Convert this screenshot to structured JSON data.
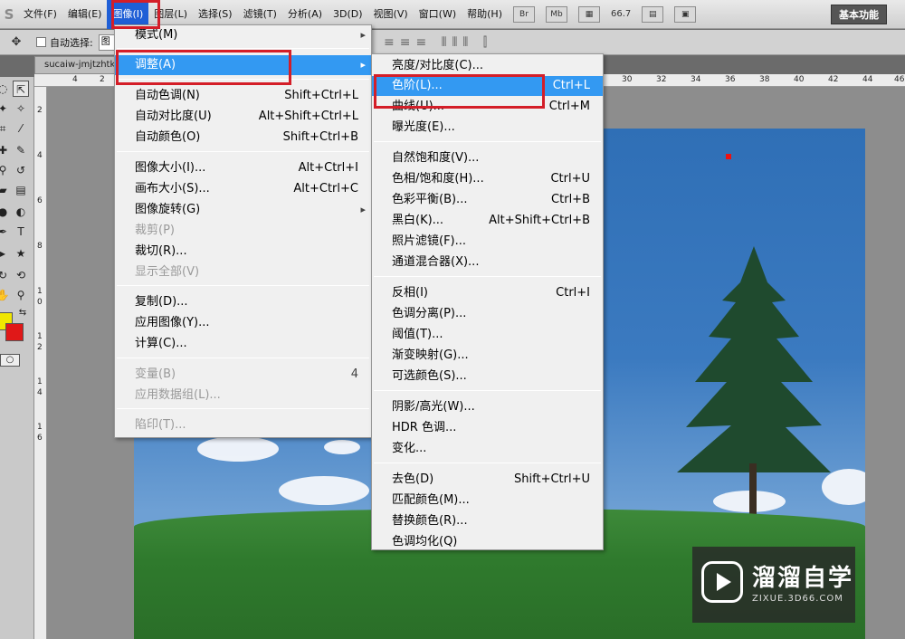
{
  "menubar": {
    "items": [
      "文件(F)",
      "编辑(E)",
      "图像(I)",
      "图层(L)",
      "选择(S)",
      "滤镜(T)",
      "分析(A)",
      "3D(D)",
      "视图(V)",
      "窗口(W)",
      "帮助(H)"
    ],
    "bridge_label": "Br",
    "minibridge_label": "Mb",
    "zoom": "66.7",
    "workspace": "基本功能"
  },
  "options": {
    "auto_select_label": "自动选择:",
    "auto_select_value": "图"
  },
  "document": {
    "tab_title": "sucaiw-jmjtzhtk"
  },
  "rulers": {
    "h_left": [
      "4",
      "2"
    ],
    "h_right": [
      "30",
      "32",
      "34",
      "36",
      "38",
      "40",
      "42",
      "44",
      "46"
    ],
    "v": [
      "2",
      "4",
      "6",
      "8",
      "1",
      "0",
      "1",
      "2",
      "1",
      "4",
      "1",
      "6"
    ]
  },
  "image_menu": {
    "items": [
      {
        "label": "模式(M)",
        "shortcut": ""
      },
      {
        "label": "调整(A)",
        "shortcut": ""
      },
      {
        "label": "自动色调(N)",
        "shortcut": "Shift+Ctrl+L"
      },
      {
        "label": "自动对比度(U)",
        "shortcut": "Alt+Shift+Ctrl+L"
      },
      {
        "label": "自动颜色(O)",
        "shortcut": "Shift+Ctrl+B"
      },
      {
        "label": "图像大小(I)...",
        "shortcut": "Alt+Ctrl+I"
      },
      {
        "label": "画布大小(S)...",
        "shortcut": "Alt+Ctrl+C"
      },
      {
        "label": "图像旋转(G)",
        "shortcut": ""
      },
      {
        "label": "裁剪(P)",
        "shortcut": ""
      },
      {
        "label": "裁切(R)...",
        "shortcut": ""
      },
      {
        "label": "显示全部(V)",
        "shortcut": ""
      },
      {
        "label": "复制(D)...",
        "shortcut": ""
      },
      {
        "label": "应用图像(Y)...",
        "shortcut": ""
      },
      {
        "label": "计算(C)...",
        "shortcut": ""
      },
      {
        "label": "变量(B)",
        "shortcut": "4"
      },
      {
        "label": "应用数据组(L)...",
        "shortcut": ""
      },
      {
        "label": "陷印(T)...",
        "shortcut": ""
      }
    ]
  },
  "adjust_menu": {
    "items": [
      {
        "label": "亮度/对比度(C)...",
        "shortcut": ""
      },
      {
        "label": "色阶(L)...",
        "shortcut": "Ctrl+L"
      },
      {
        "label": "曲线(U)...",
        "shortcut": "Ctrl+M"
      },
      {
        "label": "曝光度(E)...",
        "shortcut": ""
      },
      {
        "label": "自然饱和度(V)...",
        "shortcut": ""
      },
      {
        "label": "色相/饱和度(H)...",
        "shortcut": "Ctrl+U"
      },
      {
        "label": "色彩平衡(B)...",
        "shortcut": "Ctrl+B"
      },
      {
        "label": "黑白(K)...",
        "shortcut": "Alt+Shift+Ctrl+B"
      },
      {
        "label": "照片滤镜(F)...",
        "shortcut": ""
      },
      {
        "label": "通道混合器(X)...",
        "shortcut": ""
      },
      {
        "label": "反相(I)",
        "shortcut": "Ctrl+I"
      },
      {
        "label": "色调分离(P)...",
        "shortcut": ""
      },
      {
        "label": "阈值(T)...",
        "shortcut": ""
      },
      {
        "label": "渐变映射(G)...",
        "shortcut": ""
      },
      {
        "label": "可选颜色(S)...",
        "shortcut": ""
      },
      {
        "label": "阴影/高光(W)...",
        "shortcut": ""
      },
      {
        "label": "HDR 色调...",
        "shortcut": ""
      },
      {
        "label": "变化...",
        "shortcut": ""
      },
      {
        "label": "去色(D)",
        "shortcut": "Shift+Ctrl+U"
      },
      {
        "label": "匹配颜色(M)...",
        "shortcut": ""
      },
      {
        "label": "替换颜色(R)...",
        "shortcut": ""
      },
      {
        "label": "色调均化(Q)",
        "shortcut": ""
      }
    ]
  },
  "watermark": {
    "title": "溜溜自学",
    "url": "ZIXUE.3D66.COM"
  },
  "colors": {
    "menu_highlight": "#3399f2",
    "annotation_red": "#d41e28",
    "foreground": "#f0e600",
    "background": "#e01818"
  }
}
